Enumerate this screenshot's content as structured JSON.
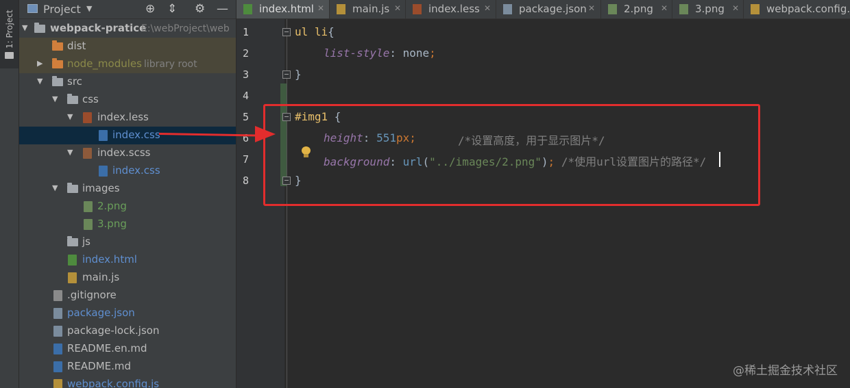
{
  "tool_strip": {
    "label": "1: Project"
  },
  "panel_header": {
    "title": "Project"
  },
  "tree": [
    {
      "label": "webpack-pratice",
      "hint": "E:\\webProject\\web",
      "type": "folder",
      "bold": true
    },
    {
      "label": "dist",
      "type": "folder"
    },
    {
      "label": "node_modules",
      "hint": "library root",
      "type": "folder"
    },
    {
      "label": "src",
      "type": "folder"
    },
    {
      "label": "css",
      "type": "folder"
    },
    {
      "label": "index.less",
      "type": "less"
    },
    {
      "label": "index.css",
      "type": "css"
    },
    {
      "label": "index.scss",
      "type": "sass"
    },
    {
      "label": "index.css",
      "type": "css"
    },
    {
      "label": "images",
      "type": "folder"
    },
    {
      "label": "2.png",
      "type": "png"
    },
    {
      "label": "3.png",
      "type": "png"
    },
    {
      "label": "js",
      "type": "folder"
    },
    {
      "label": "index.html",
      "type": "html"
    },
    {
      "label": "main.js",
      "type": "js"
    },
    {
      "label": ".gitignore",
      "type": "gitignore"
    },
    {
      "label": "package.json",
      "type": "json"
    },
    {
      "label": "package-lock.json",
      "type": "json"
    },
    {
      "label": "README.en.md",
      "type": "md"
    },
    {
      "label": "README.md",
      "type": "md"
    },
    {
      "label": "webpack.config.js",
      "type": "js"
    }
  ],
  "tabs": [
    {
      "label": "index.html"
    },
    {
      "label": "main.js"
    },
    {
      "label": "index.less"
    },
    {
      "label": "package.json"
    },
    {
      "label": "2.png"
    },
    {
      "label": "3.png"
    },
    {
      "label": "webpack.config.js"
    }
  ],
  "line_numbers": [
    "1",
    "2",
    "3",
    "4",
    "5",
    "6",
    "7",
    "8"
  ],
  "code": {
    "line1": {
      "selector": "ul li",
      "open": "{"
    },
    "line2": {
      "prop": "list-style",
      "colon": ": ",
      "value": "none",
      "semi": ";"
    },
    "line3": {
      "close": "}"
    },
    "line5": {
      "selector": "#img1",
      "open": " {"
    },
    "line6": {
      "prop": "height",
      "colon": ": ",
      "num": "551",
      "unit": "px",
      "semi": ";",
      "comment": "/*设置高度，用于显示图片*/"
    },
    "line7": {
      "prop": "background",
      "colon": ": ",
      "fn": "url",
      "paren_open": "(",
      "str": "\"../images/2.png\"",
      "paren_close": ")",
      "semi": "; ",
      "comment": "/*使用url设置图片的路径*/"
    },
    "line8": {
      "close": "}"
    }
  },
  "watermark": "@稀土掘金技术社区"
}
